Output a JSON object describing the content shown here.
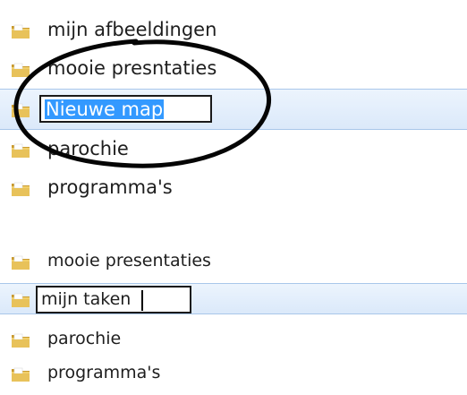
{
  "top_panel": {
    "rows": [
      {
        "label": "mijn afbeeldingen",
        "icon": "folder-icon"
      },
      {
        "label": "mooie presntaties",
        "icon": "folder-icon"
      },
      {
        "label": "Nieuwe map",
        "icon": "folder-icon",
        "state": "renaming, text selected"
      },
      {
        "label": "parochie",
        "icon": "folder-icon"
      },
      {
        "label": "programma's",
        "icon": "folder-icon"
      }
    ],
    "annotation": "hand-drawn black ellipse circling the Nieuwe map row"
  },
  "bottom_panel": {
    "rows": [
      {
        "label": "mooie presentaties",
        "icon": "folder-icon"
      },
      {
        "label": "mijn taken",
        "icon": "folder-icon",
        "state": "renaming, caret after text"
      },
      {
        "label": "parochie",
        "icon": "folder-icon"
      },
      {
        "label": "programma's",
        "icon": "folder-icon"
      }
    ]
  },
  "colors": {
    "selection_row": "#dbe9fa",
    "selection_border": "#a9c7ea",
    "text_highlight": "#3399ff",
    "folder": "#e8c25a"
  }
}
